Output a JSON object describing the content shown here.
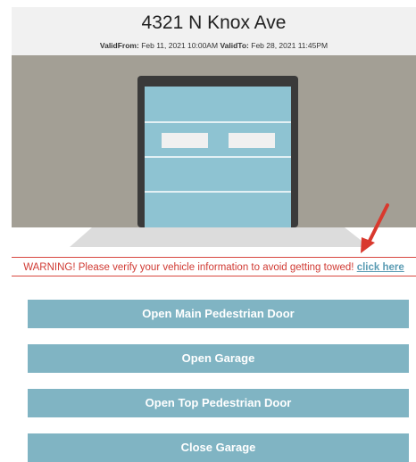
{
  "header": {
    "address": "4321 N Knox Ave",
    "valid_from_label": "ValidFrom:",
    "valid_from": "Feb 11, 2021 10:00AM",
    "valid_to_label": "ValidTo:",
    "valid_to": "Feb 28, 2021 11:45PM"
  },
  "warning": {
    "text": "WARNING! Please verify your vehicle information to avoid getting towed!",
    "link": "click here"
  },
  "buttons": [
    {
      "label": "Open Main Pedestrian Door"
    },
    {
      "label": "Open Garage"
    },
    {
      "label": "Open Top Pedestrian Door"
    },
    {
      "label": "Close Garage"
    }
  ],
  "colors": {
    "wall": "#a39f95",
    "door": "#8ec3d2",
    "frame": "#3a3a3a",
    "button": "#80b4c3",
    "warning": "#d03a33",
    "link": "#5a9bb3",
    "annotation_arrow": "#d9392e"
  }
}
